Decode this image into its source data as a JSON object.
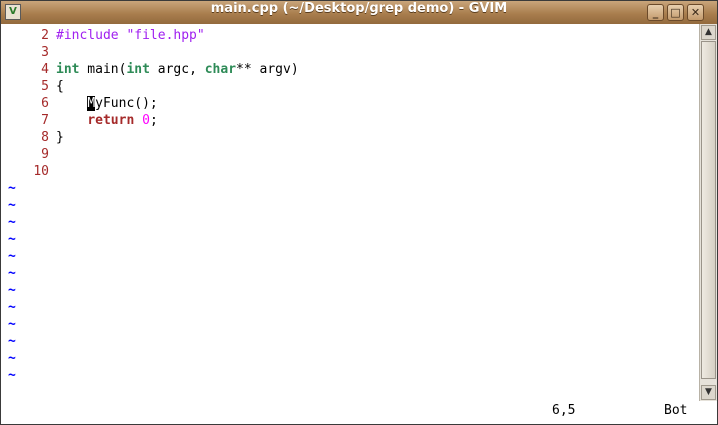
{
  "window": {
    "title": "main.cpp (~/Desktop/grep demo) - GVIM",
    "minimize_glyph": "_",
    "maximize_glyph": "□",
    "close_glyph": "✕",
    "icon": "vim-icon"
  },
  "editor": {
    "lines": [
      {
        "num": "2",
        "parts": [
          {
            "t": "#include \"file.hpp\"",
            "c": "pre"
          }
        ]
      },
      {
        "num": "3",
        "parts": []
      },
      {
        "num": "4",
        "parts": [
          {
            "t": "int",
            "c": "type"
          },
          {
            "t": " main(",
            "c": ""
          },
          {
            "t": "int",
            "c": "type"
          },
          {
            "t": " argc, ",
            "c": ""
          },
          {
            "t": "char",
            "c": "type"
          },
          {
            "t": "** argv)",
            "c": ""
          }
        ]
      },
      {
        "num": "5",
        "parts": [
          {
            "t": "{",
            "c": ""
          }
        ]
      },
      {
        "num": "6",
        "parts": [
          {
            "t": "    ",
            "c": ""
          },
          {
            "t": "M",
            "c": "cursor"
          },
          {
            "t": "yFunc();",
            "c": ""
          }
        ]
      },
      {
        "num": "7",
        "parts": [
          {
            "t": "    ",
            "c": ""
          },
          {
            "t": "return",
            "c": "kw"
          },
          {
            "t": " ",
            "c": ""
          },
          {
            "t": "0",
            "c": "num"
          },
          {
            "t": ";",
            "c": ""
          }
        ]
      },
      {
        "num": "8",
        "parts": [
          {
            "t": "}",
            "c": ""
          }
        ]
      },
      {
        "num": "9",
        "parts": []
      },
      {
        "num": "10",
        "parts": []
      }
    ],
    "tilde_char": "~",
    "tilde_count": 12
  },
  "statusbar": {
    "cursor_position": "6,5",
    "scroll_position": "Bot"
  },
  "colors": {
    "line_number": "#a52a2a",
    "preproc": "#a020f0",
    "type": "#2e8b57",
    "keyword": "#a52a2a",
    "number": "#ff00ff",
    "tilde": "#0000ff"
  }
}
